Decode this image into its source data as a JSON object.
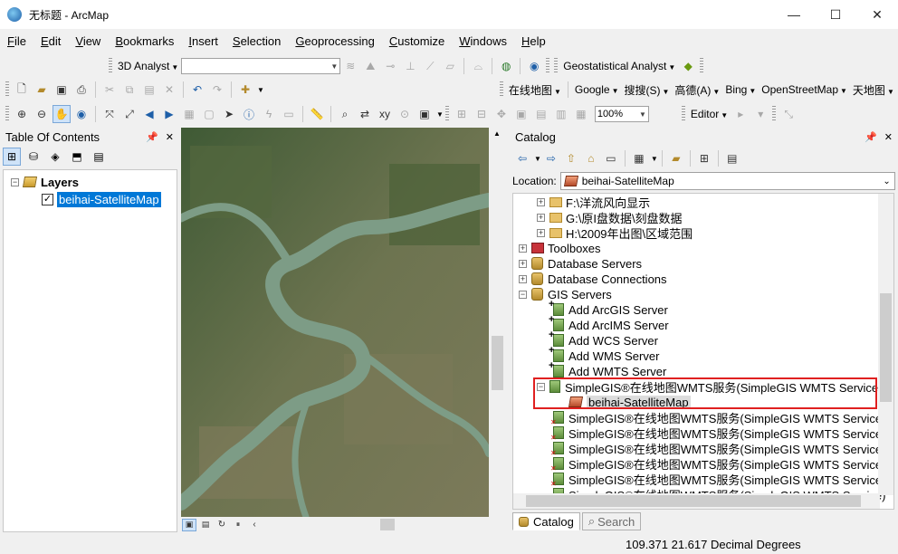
{
  "window": {
    "title": "无标题 - ArcMap"
  },
  "menu": [
    {
      "label": "File",
      "hotkey": "F"
    },
    {
      "label": "Edit",
      "hotkey": "E"
    },
    {
      "label": "View",
      "hotkey": "V"
    },
    {
      "label": "Bookmarks",
      "hotkey": "B"
    },
    {
      "label": "Insert",
      "hotkey": "I"
    },
    {
      "label": "Selection",
      "hotkey": "S"
    },
    {
      "label": "Geoprocessing",
      "hotkey": "G"
    },
    {
      "label": "Customize",
      "hotkey": "C"
    },
    {
      "label": "Windows",
      "hotkey": "W"
    },
    {
      "label": "Help",
      "hotkey": "H"
    }
  ],
  "toolbar1": {
    "analyst_3d": "3D Analyst",
    "geostatistical": "Geostatistical Analyst"
  },
  "toolbar2": {
    "online_map": "在线地图",
    "google": "Google",
    "sogou": "搜搜(S)",
    "gaode": "高德(A)",
    "bing": "Bing",
    "osm": "OpenStreetMap",
    "tianditu": "天地图"
  },
  "toolbar3": {
    "zoom_value": "100%",
    "editor": "Editor"
  },
  "toc": {
    "title": "Table Of Contents",
    "layers_group": "Layers",
    "layer_name": "beihai-SatelliteMap",
    "layer_checked": "✓"
  },
  "catalog": {
    "title": "Catalog",
    "location_label": "Location:",
    "location_value": "beihai-SatelliteMap",
    "items": {
      "f_drive": "F:\\洋流风向显示",
      "g_drive": "G:\\原I盘数据\\刻盘数据",
      "h_drive": "H:\\2009年出图\\区域范围",
      "toolboxes": "Toolboxes",
      "database_servers": "Database Servers",
      "database_connections": "Database Connections",
      "gis_servers": "GIS Servers",
      "add_arcgis": "Add ArcGIS Server",
      "add_arcims": "Add ArcIMS Server",
      "add_wcs": "Add WCS Server",
      "add_wms": "Add WMS Server",
      "add_wmts": "Add WMTS Server",
      "simplegis_service": "SimpleGIS®在线地图WMTS服务(SimpleGIS WMTS Service)",
      "service_layer": "beihai-SatelliteMap",
      "simplegis_service_2": "SimpleGIS®在线地图WMTS服务(SimpleGIS WMTS Service)",
      "simplegis_service_3": "SimpleGIS®在线地图WMTS服务(SimpleGIS WMTS Service)",
      "simplegis_service_4": "SimpleGIS®在线地图WMTS服务(SimpleGIS WMTS Service)",
      "simplegis_service_5": "SimpleGIS®在线地图WMTS服务(SimpleGIS WMTS Service)",
      "simplegis_service_6": "SimpleGIS®在线地图WMTS服务(SimpleGIS WMTS Service)",
      "simplegis_service_7": "SimpleGIS®在线地图WMTS服务(SimpleGIS WMTS Service)"
    },
    "tabs": {
      "catalog": "Catalog",
      "search": "Search"
    }
  },
  "status": {
    "coordinates": "109.371  21.617 Decimal Degrees"
  },
  "colors": {
    "selection": "#0078d7",
    "highlight": "#e02020"
  }
}
